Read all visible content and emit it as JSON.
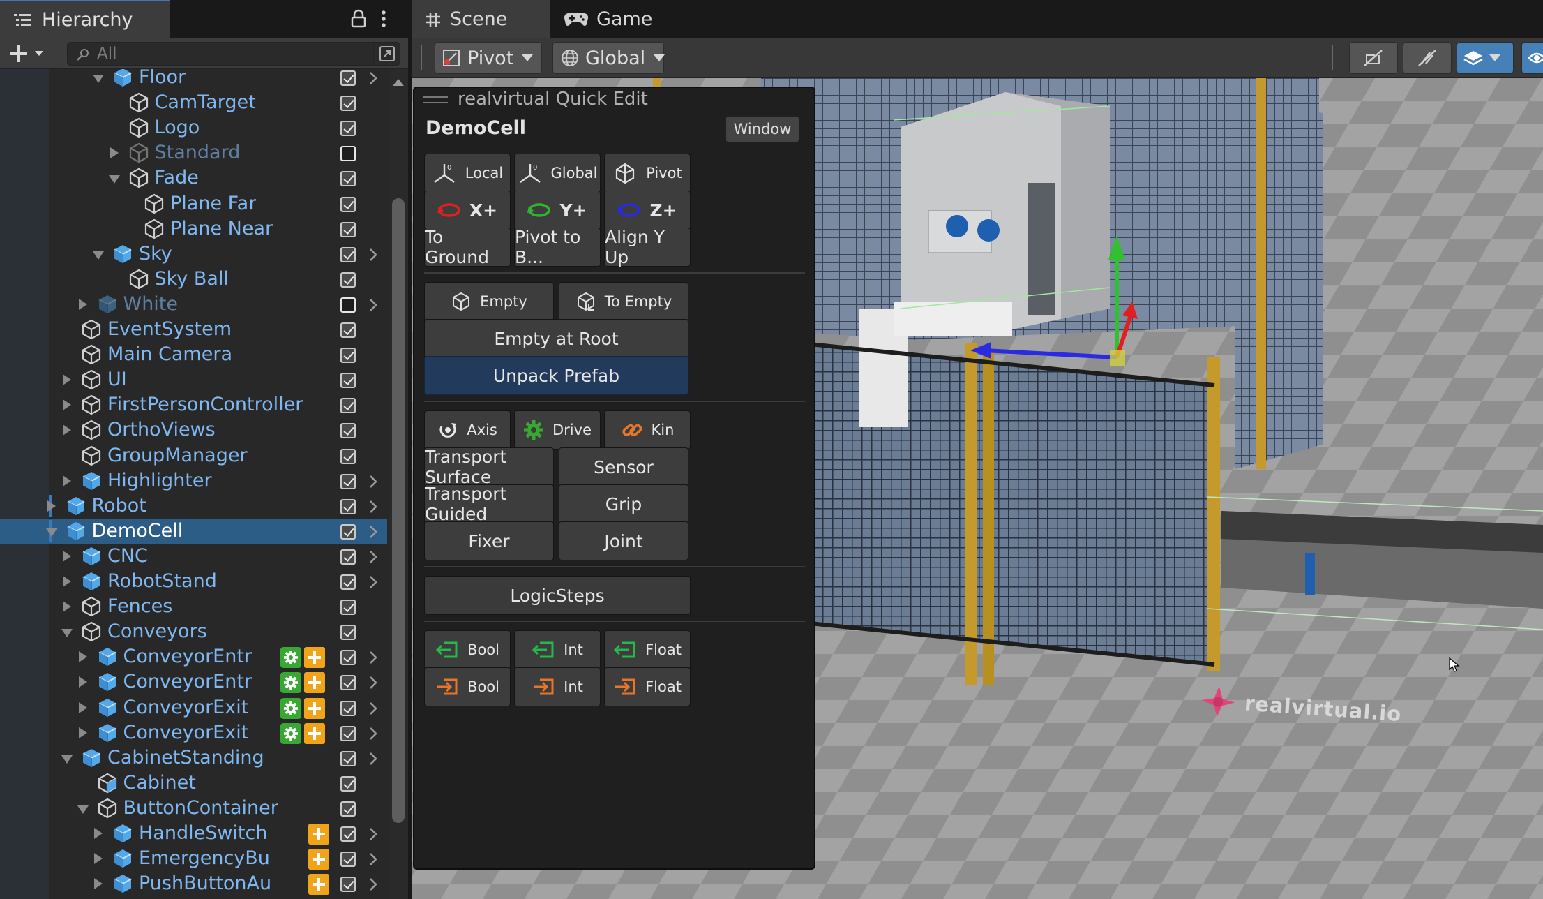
{
  "hierarchy": {
    "tab_label": "Hierarchy",
    "search_placeholder": "All",
    "rows": [
      {
        "name": "Floor",
        "indent": 6,
        "arrow": "down",
        "cube": "filled",
        "active": true,
        "check": true,
        "chevron": true
      },
      {
        "name": "CamTarget",
        "indent": 7,
        "arrow": "none",
        "cube": "outline",
        "active": true,
        "check": true,
        "chevron": false
      },
      {
        "name": "Logo",
        "indent": 7,
        "arrow": "none",
        "cube": "outline",
        "active": true,
        "check": true,
        "chevron": false
      },
      {
        "name": "Standard",
        "indent": 7,
        "arrow": "right",
        "cube": "outline",
        "active": false,
        "check": false,
        "chevron": false
      },
      {
        "name": "Fade",
        "indent": 7,
        "arrow": "down",
        "cube": "outline",
        "active": true,
        "check": true,
        "chevron": false
      },
      {
        "name": "Plane Far",
        "indent": 8,
        "arrow": "none",
        "cube": "outline",
        "active": true,
        "check": true,
        "chevron": false
      },
      {
        "name": "Plane Near",
        "indent": 8,
        "arrow": "none",
        "cube": "outline",
        "active": true,
        "check": true,
        "chevron": false
      },
      {
        "name": "Sky",
        "indent": 6,
        "arrow": "down",
        "cube": "filled",
        "active": true,
        "check": true,
        "chevron": true
      },
      {
        "name": "Sky Ball",
        "indent": 7,
        "arrow": "none",
        "cube": "outline",
        "active": true,
        "check": true,
        "chevron": false
      },
      {
        "name": "White",
        "indent": 5,
        "arrow": "right",
        "cube": "filled",
        "active": false,
        "check": false,
        "chevron": true
      },
      {
        "name": "EventSystem",
        "indent": 4,
        "arrow": "none",
        "cube": "outline",
        "active": true,
        "check": true,
        "chevron": false
      },
      {
        "name": "Main Camera",
        "indent": 4,
        "arrow": "none",
        "cube": "outline",
        "active": true,
        "check": true,
        "chevron": false
      },
      {
        "name": "UI",
        "indent": 4,
        "arrow": "right",
        "cube": "outline",
        "active": true,
        "check": true,
        "chevron": false
      },
      {
        "name": "FirstPersonController",
        "indent": 4,
        "arrow": "right",
        "cube": "outline",
        "active": true,
        "check": true,
        "chevron": false
      },
      {
        "name": "OrthoViews",
        "indent": 4,
        "arrow": "right",
        "cube": "outline",
        "active": true,
        "check": true,
        "chevron": false
      },
      {
        "name": "GroupManager",
        "indent": 4,
        "arrow": "none",
        "cube": "outline",
        "active": true,
        "check": true,
        "chevron": false
      },
      {
        "name": "Highlighter",
        "indent": 4,
        "arrow": "right",
        "cube": "filled",
        "active": true,
        "check": true,
        "chevron": true
      },
      {
        "name": "Robot",
        "indent": 3,
        "arrow": "right",
        "cube": "filled",
        "active": true,
        "check": true,
        "chevron": true
      },
      {
        "name": "DemoCell",
        "indent": 3,
        "arrow": "down",
        "cube": "filled",
        "active": true,
        "check": true,
        "chevron": true,
        "selected": true
      },
      {
        "name": "CNC",
        "indent": 4,
        "arrow": "right",
        "cube": "filled",
        "active": true,
        "check": true,
        "chevron": true
      },
      {
        "name": "RobotStand",
        "indent": 4,
        "arrow": "right",
        "cube": "filled",
        "active": true,
        "check": true,
        "chevron": true
      },
      {
        "name": "Fences",
        "indent": 4,
        "arrow": "right",
        "cube": "outline",
        "active": true,
        "check": true,
        "chevron": false
      },
      {
        "name": "Conveyors",
        "indent": 4,
        "arrow": "down",
        "cube": "outline",
        "active": true,
        "check": true,
        "chevron": false
      },
      {
        "name": "ConveyorEntr",
        "indent": 5,
        "arrow": "right",
        "cube": "filled",
        "active": true,
        "check": true,
        "chevron": true,
        "badges": 2
      },
      {
        "name": "ConveyorEntr",
        "indent": 5,
        "arrow": "right",
        "cube": "filled",
        "active": true,
        "check": true,
        "chevron": true,
        "badges": 2
      },
      {
        "name": "ConveyorExit",
        "indent": 5,
        "arrow": "right",
        "cube": "filled",
        "active": true,
        "check": true,
        "chevron": true,
        "badges": 2
      },
      {
        "name": "ConveyorExit",
        "indent": 5,
        "arrow": "right",
        "cube": "filled",
        "active": true,
        "check": true,
        "chevron": true,
        "badges": 2
      },
      {
        "name": "CabinetStanding",
        "indent": 4,
        "arrow": "down",
        "cube": "filled",
        "active": true,
        "check": true,
        "chevron": true
      },
      {
        "name": "Cabinet",
        "indent": 5,
        "arrow": "none",
        "cube": "half",
        "active": true,
        "check": true,
        "chevron": false
      },
      {
        "name": "ButtonContainer",
        "indent": 5,
        "arrow": "down",
        "cube": "outline",
        "active": true,
        "check": true,
        "chevron": false
      },
      {
        "name": "HandleSwitch",
        "indent": 6,
        "arrow": "right",
        "cube": "filled",
        "active": true,
        "check": true,
        "chevron": true,
        "badges": 1
      },
      {
        "name": "EmergencyBu",
        "indent": 6,
        "arrow": "right",
        "cube": "filled",
        "active": true,
        "check": true,
        "chevron": true,
        "badges": 1
      },
      {
        "name": "PushButtonAu",
        "indent": 6,
        "arrow": "right",
        "cube": "filled",
        "active": true,
        "check": true,
        "chevron": true,
        "badges": 1
      }
    ]
  },
  "scene": {
    "tabs": [
      {
        "label": "Scene",
        "icon": "grid-icon"
      },
      {
        "label": "Game",
        "icon": "gamepad-icon"
      }
    ],
    "pivot_label": "Pivot",
    "global_label": "Global",
    "watermark": "realvirtual.io"
  },
  "quick_edit": {
    "title": "realvirtual Quick Edit",
    "object_name": "DemoCell",
    "window_button": "Window",
    "row1": [
      "Local",
      "Global",
      "Pivot"
    ],
    "row2": [
      "X+",
      "Y+",
      "Z+"
    ],
    "row3": [
      "To Ground",
      "Pivot to B...",
      "Align Y Up"
    ],
    "row4": [
      "Empty",
      "To Empty"
    ],
    "empty_root": "Empty at Root",
    "unpack": "Unpack Prefab",
    "row5": [
      "Axis",
      "Drive",
      "Kin"
    ],
    "row6": [
      "Transport Surface",
      "Sensor"
    ],
    "row7": [
      "Transport Guided",
      "Grip"
    ],
    "row8": [
      "Fixer",
      "Joint"
    ],
    "logicsteps": "LogicSteps",
    "signals_in": [
      "Bool",
      "Int",
      "Float"
    ],
    "signals_out": [
      "Bool",
      "Int",
      "Float"
    ]
  },
  "colors": {
    "accent": "#3a79bb",
    "selected_row": "#2c5d87",
    "name_active": "#7fb7f0",
    "name_inactive": "#5f7f9f",
    "rot_x": "#e02020",
    "rot_y": "#2fb52f",
    "rot_z": "#2a2ae0",
    "signal_in": "#27b84a",
    "signal_out": "#e8762a"
  }
}
